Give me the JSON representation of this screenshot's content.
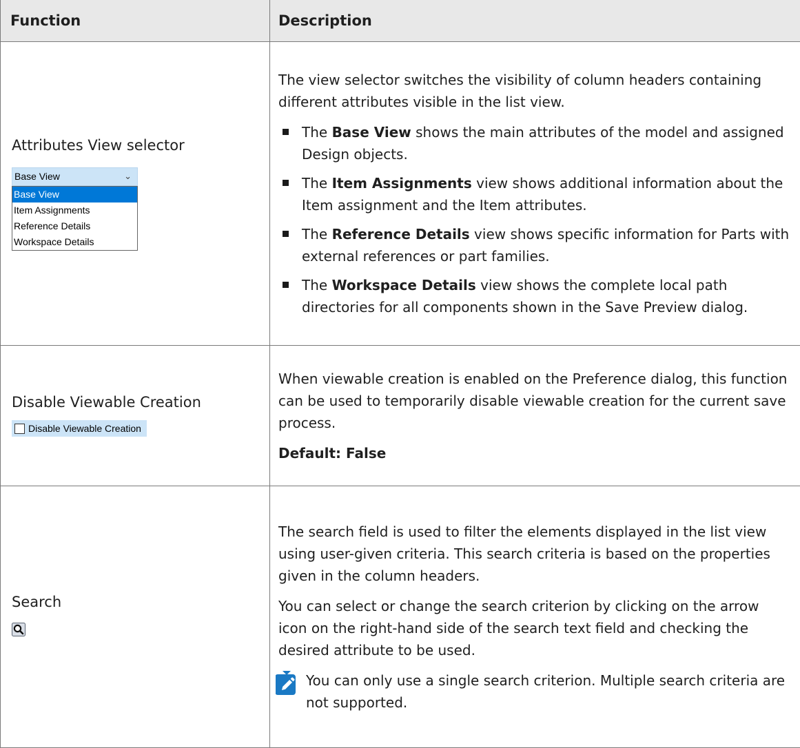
{
  "headers": {
    "function": "Function",
    "description": "Description"
  },
  "rows": {
    "attributes": {
      "function": "Attributes View selector",
      "dropdown_selected": "Base View",
      "dropdown_options": [
        "Base View",
        "Item Assignments",
        "Reference Details",
        "Workspace Details"
      ],
      "intro": "The view selector switches the visibility of column headers containing different attributes visible in the list view.",
      "bullets": [
        {
          "pre": "The ",
          "bold": "Base View",
          "post": " shows the main attributes of the model and assigned Design objects."
        },
        {
          "pre": "The ",
          "bold": "Item Assignments",
          "post": " view shows additional information about the Item assignment and the Item attributes."
        },
        {
          "pre": "The ",
          "bold": "Reference Details",
          "post": " view shows specific information for Parts with external references or part families."
        },
        {
          "pre": "The ",
          "bold": "Workspace Details",
          "post": " view shows the complete local path directories for all components shown in the Save Preview dialog."
        }
      ]
    },
    "viewable": {
      "function": "Disable Viewable Creation",
      "checkbox_label": "Disable Viewable Creation",
      "description": "When viewable creation is enabled on the Preference dialog, this function can be used to temporarily disable viewable creation for the current save process.",
      "default": "Default: False"
    },
    "search": {
      "function": "Search",
      "icon": "search-icon",
      "p1": "The search field is used to filter the elements displayed in the list view using user-given criteria. This search criteria is based on the properties given in the column headers.",
      "p2": "You can select or change the search criterion by clicking on the arrow icon on the right-hand side of the search text field and checking the desired attribute to be used.",
      "note": "You can only use a single search criterion. Multiple search criteria are not supported."
    }
  },
  "colors": {
    "accent": "#0078d7",
    "note_icon": "#1a79c4",
    "header_bg": "#e8e8e8"
  }
}
